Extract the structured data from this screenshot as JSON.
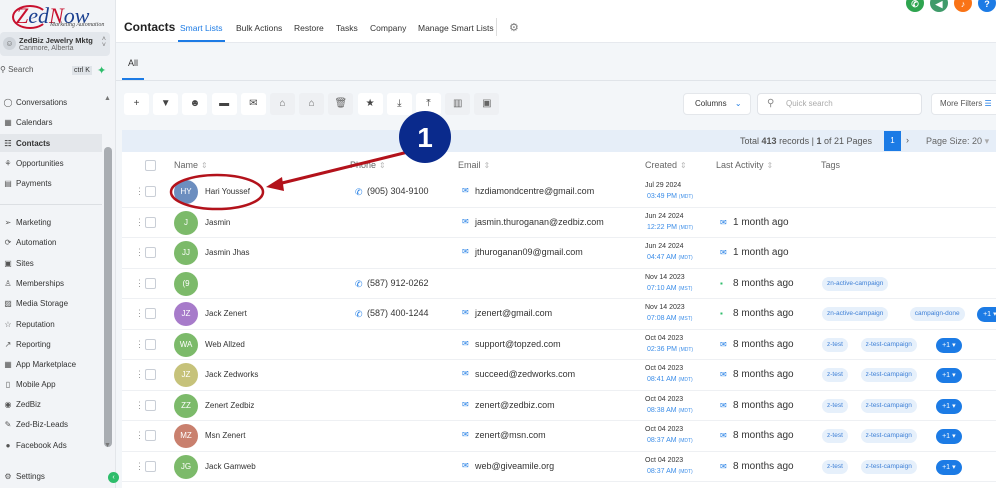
{
  "brand": {
    "logo_text": "ZedNow",
    "logo_subtitle": "Marketing Automation"
  },
  "account": {
    "name": "ZedBiz Jewelry Mktg",
    "location": "Canmore, Alberta"
  },
  "search": {
    "label": "Search",
    "shortcut": "ctrl K"
  },
  "sidebar": {
    "items": [
      {
        "label": "Conversations",
        "icon": "chat-icon"
      },
      {
        "label": "Calendars",
        "icon": "calendar-icon"
      },
      {
        "label": "Contacts",
        "icon": "contacts-icon",
        "active": true
      },
      {
        "label": "Opportunities",
        "icon": "opportunities-icon"
      },
      {
        "label": "Payments",
        "icon": "payments-icon"
      },
      {
        "label": "Marketing",
        "icon": "send-icon"
      },
      {
        "label": "Automation",
        "icon": "automation-icon"
      },
      {
        "label": "Sites",
        "icon": "sites-icon"
      },
      {
        "label": "Memberships",
        "icon": "memberships-icon"
      },
      {
        "label": "Media Storage",
        "icon": "media-icon"
      },
      {
        "label": "Reputation",
        "icon": "star-icon"
      },
      {
        "label": "Reporting",
        "icon": "reporting-icon"
      },
      {
        "label": "App Marketplace",
        "icon": "grid-icon"
      },
      {
        "label": "Mobile App",
        "icon": "mobile-icon"
      },
      {
        "label": "ZedBiz",
        "icon": "zedbiz-icon"
      },
      {
        "label": "Zed-Biz-Leads",
        "icon": "wrench-icon"
      },
      {
        "label": "Facebook Ads",
        "icon": "facebook-icon"
      }
    ],
    "settings": "Settings"
  },
  "header": {
    "title": "Contacts",
    "tabs": [
      "Smart Lists",
      "Bulk Actions",
      "Restore",
      "Tasks",
      "Company",
      "Manage Smart Lists"
    ],
    "active_tab": "Smart Lists"
  },
  "top_icons": [
    {
      "icon": "phone-icon",
      "color": "#2ea44f"
    },
    {
      "icon": "megaphone-icon",
      "color": "#3f9b6a"
    },
    {
      "icon": "bell-icon",
      "color": "#f97316"
    },
    {
      "icon": "help-icon",
      "color": "#1c7be5",
      "label": "?"
    }
  ],
  "list_tab": "All",
  "toolbar": {
    "buttons": [
      "add-icon",
      "filter-icon",
      "robot-icon",
      "sms-icon",
      "email-icon",
      "add-tag-icon",
      "remove-tag-icon",
      "delete-icon",
      "star-icon",
      "import-icon",
      "export-icon",
      "company-icon",
      "merge-icon"
    ],
    "columns": "Columns",
    "quick_search_placeholder": "Quick search",
    "more_filters": "More Filters"
  },
  "pagination": {
    "total": "413",
    "current": "1",
    "pages": "21",
    "page_size": "20",
    "text_prefix": "Total",
    "text_records": "records |",
    "text_of": "of 21 Pages",
    "page_size_label": "Page Size: 20"
  },
  "columns": [
    "Name",
    "Phone",
    "Email",
    "Created",
    "Last Activity",
    "Tags"
  ],
  "contacts": [
    {
      "initials": "HY",
      "name": "Hari Youssef",
      "color": "#6c8ebf",
      "phone": "(905) 304-9100",
      "email": "hzdiamondcentre@gmail.com",
      "date": "Jul 29 2024",
      "time": "03:49 PM",
      "tz": "(MDT)",
      "activity": "",
      "activity_icon": "",
      "tags": [],
      "more": ""
    },
    {
      "initials": "J",
      "name": "Jasmin",
      "color": "#7cba6a",
      "phone": "",
      "email": "jasmin.thuroganan@zedbiz.com",
      "date": "Jun 24 2024",
      "time": "12:22 PM",
      "tz": "(MDT)",
      "activity": "1 month ago",
      "activity_icon": "email",
      "tags": [],
      "more": ""
    },
    {
      "initials": "JJ",
      "name": "Jasmin Jhas",
      "color": "#7cba6a",
      "phone": "",
      "email": "jthuroganan09@gmail.com",
      "date": "Jun 24 2024",
      "time": "04:47 AM",
      "tz": "(MDT)",
      "activity": "1 month ago",
      "activity_icon": "email",
      "tags": [],
      "more": ""
    },
    {
      "initials": "(9",
      "name": "",
      "color": "#7cba6a",
      "phone": "(587) 912-0262",
      "email": "",
      "date": "Nov 14 2023",
      "time": "07:10 AM",
      "tz": "(MST)",
      "activity": "8 months ago",
      "activity_icon": "sms",
      "tags": [
        "zn-active-campaign"
      ],
      "more": ""
    },
    {
      "initials": "JZ",
      "name": "Jack Zenert",
      "color": "#a77bca",
      "phone": "(587) 400-1244",
      "email": "jzenert@gmail.com",
      "date": "Nov 14 2023",
      "time": "07:08 AM",
      "tz": "(MST)",
      "activity": "8 months ago",
      "activity_icon": "sms",
      "tags": [
        "zn-active-campaign",
        "campaign-done"
      ],
      "more": "+1"
    },
    {
      "initials": "WA",
      "name": "Web Allzed",
      "color": "#7cba6a",
      "phone": "",
      "email": "support@topzed.com",
      "date": "Oct 04 2023",
      "time": "02:36 PM",
      "tz": "(MDT)",
      "activity": "8 months ago",
      "activity_icon": "email",
      "tags": [
        "z-test",
        "z-test-campaign"
      ],
      "more": "+1"
    },
    {
      "initials": "JZ",
      "name": "Jack Zedworks",
      "color": "#c6c27a",
      "phone": "",
      "email": "succeed@zedworks.com",
      "date": "Oct 04 2023",
      "time": "08:41 AM",
      "tz": "(MDT)",
      "activity": "8 months ago",
      "activity_icon": "email",
      "tags": [
        "z-test",
        "z-test-campaign"
      ],
      "more": "+1"
    },
    {
      "initials": "ZZ",
      "name": "Zenert Zedbiz",
      "color": "#7cba6a",
      "phone": "",
      "email": "zenert@zedbiz.com",
      "date": "Oct 04 2023",
      "time": "08:38 AM",
      "tz": "(MDT)",
      "activity": "8 months ago",
      "activity_icon": "email",
      "tags": [
        "z-test",
        "z-test-campaign"
      ],
      "more": "+1"
    },
    {
      "initials": "MZ",
      "name": "Msn Zenert",
      "color": "#c9806e",
      "phone": "",
      "email": "zenert@msn.com",
      "date": "Oct 04 2023",
      "time": "08:37 AM",
      "tz": "(MDT)",
      "activity": "8 months ago",
      "activity_icon": "email",
      "tags": [
        "z-test",
        "z-test-campaign"
      ],
      "more": "+1"
    },
    {
      "initials": "JG",
      "name": "Jack Gamweb",
      "color": "#7cba6a",
      "phone": "",
      "email": "web@giveamile.org",
      "date": "Oct 04 2023",
      "time": "08:37 AM",
      "tz": "(MDT)",
      "activity": "8 months ago",
      "activity_icon": "email",
      "tags": [
        "z-test",
        "z-test-campaign"
      ],
      "more": "+1"
    }
  ],
  "annotation": {
    "step": "1",
    "color": "#0a2a8c",
    "highlight_color": "#b3121b"
  }
}
